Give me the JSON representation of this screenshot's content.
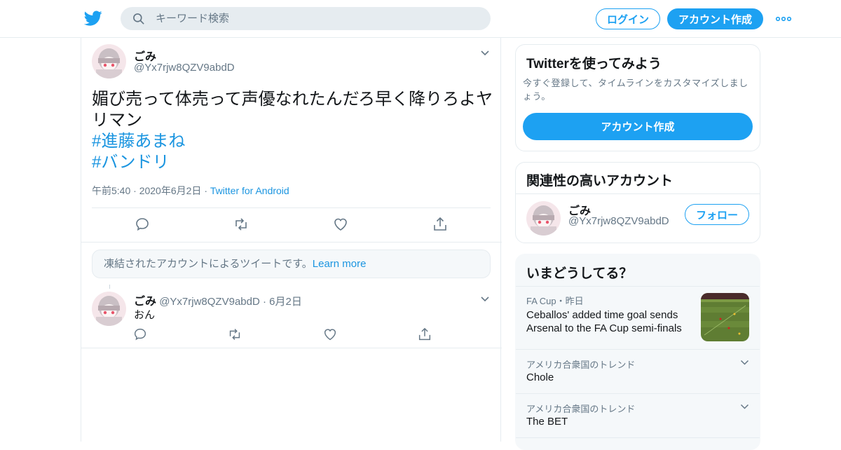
{
  "header": {
    "search_placeholder": "キーワード検索",
    "login_label": "ログイン",
    "signup_label": "アカウント作成"
  },
  "tweet": {
    "name": "ごみ",
    "handle": "@Yx7rjw8QZV9abdD",
    "text": "媚び売って体売って声優なれたんだろ早く降りろよヤリマン",
    "hashtags": [
      "#進藤あまね",
      "#バンドリ"
    ],
    "time": "午前5:40",
    "date": "2020年6月2日",
    "source": "Twitter for Android"
  },
  "notice": {
    "text": "凍結されたアカウントによるツイートです。",
    "link": "Learn more"
  },
  "reply": {
    "name": "ごみ",
    "handle": "@Yx7rjw8QZV9abdD",
    "date": "6月2日",
    "text": "おん"
  },
  "signup_card": {
    "title": "Twitterを使ってみよう",
    "description": "今すぐ登録して、タイムラインをカスタマイズしましょう。",
    "button": "アカウント作成"
  },
  "related_card": {
    "title": "関連性の高いアカウント",
    "name": "ごみ",
    "handle": "@Yx7rjw8QZV9abdD",
    "follow_label": "フォロー"
  },
  "trends_card": {
    "title": "いまどうしてる？",
    "items": [
      {
        "meta": "FA Cup・昨日",
        "headline": "Ceballos' added time goal sends Arsenal to the FA Cup semi-finals"
      },
      {
        "meta": "アメリカ合衆国のトレンド",
        "name": "Chole"
      },
      {
        "meta": "アメリカ合衆国のトレンド",
        "name": "The BET"
      }
    ]
  },
  "colors": {
    "accent": "#1da1f2",
    "link": "#1b95e0",
    "muted": "#657786",
    "border": "#e6ecf0"
  },
  "icons": [
    "twitter-logo-icon",
    "search-icon",
    "more-icon",
    "chevron-down-icon",
    "reply-icon",
    "retweet-icon",
    "like-icon",
    "share-icon"
  ]
}
